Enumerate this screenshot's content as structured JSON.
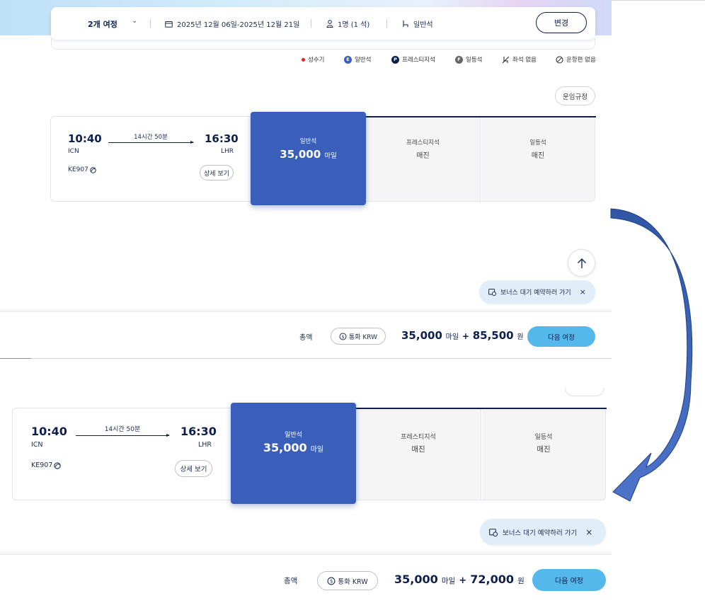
{
  "search": {
    "trip_type": "2개 여정",
    "dates": "2025년 12월 06일-2025년 12월 21일",
    "passengers": "1명 (1 석)",
    "cabin": "일반석",
    "change_label": "변경"
  },
  "legend": {
    "peak": "성수기",
    "economy_badge": "E",
    "economy": "일반석",
    "prestige_badge": "P",
    "prestige": "프레스티지석",
    "first_badge": "F",
    "first": "일등석",
    "no_seat": "좌석 없음",
    "no_flight": "운항편 없음"
  },
  "fare_rules_label": "운임규정",
  "before": {
    "flight": {
      "depart_time": "10:40",
      "depart_code": "ICN",
      "arrive_time": "16:30",
      "arrive_code": "LHR",
      "duration": "14시간 50분",
      "flight_no": "KE907",
      "detail_label": "상세 보기"
    },
    "classes": {
      "economy_label": "일반석",
      "economy_miles": "35,000",
      "miles_unit": "마일",
      "prestige_label": "프레스티지석",
      "prestige_status": "매진",
      "first_label": "일등석",
      "first_status": "매진"
    },
    "bonus_waitlist": "보너스 대기 예약하러 가기",
    "total": {
      "label": "총액",
      "currency": "통화 KRW",
      "miles": "35,000",
      "miles_unit": "마일",
      "plus": "+",
      "won": "85,500",
      "won_unit": "원",
      "next_label": "다음 여정"
    }
  },
  "after": {
    "flight": {
      "depart_time": "10:40",
      "depart_code": "ICN",
      "arrive_time": "16:30",
      "arrive_code": "LHR",
      "duration": "14시간 50분",
      "flight_no": "KE907",
      "detail_label": "상세 보기"
    },
    "classes": {
      "economy_label": "일반석",
      "economy_miles": "35,000",
      "miles_unit": "마일",
      "prestige_label": "프레스티지석",
      "prestige_status": "매진",
      "first_label": "일등석",
      "first_status": "매진"
    },
    "bonus_waitlist": "보너스 대기 예약하러 가기",
    "total": {
      "label": "총액",
      "currency": "통화 KRW",
      "miles": "35,000",
      "miles_unit": "마일",
      "plus": "+",
      "won": "72,000",
      "won_unit": "원",
      "next_label": "다음 여정"
    }
  },
  "colors": {
    "navy": "#0e1f4d",
    "selected_blue": "#3a5fbb",
    "next_button": "#55b8ea",
    "peak_red": "#e2231a",
    "annotation_arrow": "#3a62b8"
  }
}
